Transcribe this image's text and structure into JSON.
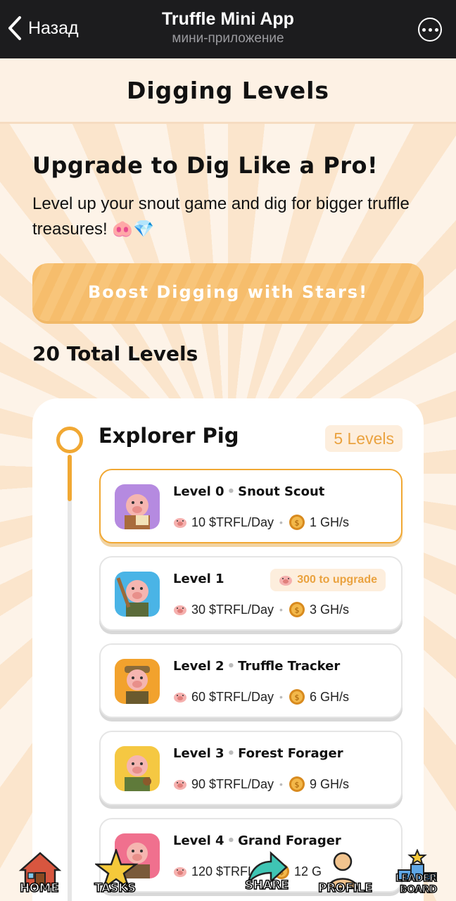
{
  "topbar": {
    "back_label": "Назад",
    "title": "Truffle Mini App",
    "subtitle": "мини-приложение"
  },
  "header": {
    "title": "Digging Levels"
  },
  "intro": {
    "title": "Upgrade to Dig Like a Pro!",
    "description": "Level up your snout game and dig for bigger truffle treasures! 🐽💎",
    "boost_button": "Boost Digging with Stars!"
  },
  "total_levels": "20 Total Levels",
  "group": {
    "title": "Explorer Pig",
    "badge": "5 Levels",
    "levels": [
      {
        "level": "Level 0",
        "name": "Snout Scout",
        "income": "10 $TRFL/Day",
        "speed": "1 GH/s",
        "active": true
      },
      {
        "level": "Level 1",
        "name": "",
        "upgrade": "300 to upgrade",
        "income": "30 $TRFL/Day",
        "speed": "3 GH/s"
      },
      {
        "level": "Level 2",
        "name": "Truffle Tracker",
        "income": "60 $TRFL/Day",
        "speed": "6 GH/s"
      },
      {
        "level": "Level 3",
        "name": "Forest Forager",
        "income": "90 $TRFL/Day",
        "speed": "9 GH/s"
      },
      {
        "level": "Level 4",
        "name": "Grand Forager",
        "income": "120 $TRFL/",
        "speed": "12 G"
      }
    ]
  },
  "nav": {
    "home": "HOME",
    "tasks": "TASKS",
    "share": "SHARE",
    "profile": "PROFILE",
    "leaderboard_1": "LEADER",
    "leaderboard_2": "BOARD"
  },
  "colors": {
    "accent": "#f1a833",
    "background": "#fdf1e4",
    "topbar": "#1c1c1e"
  }
}
